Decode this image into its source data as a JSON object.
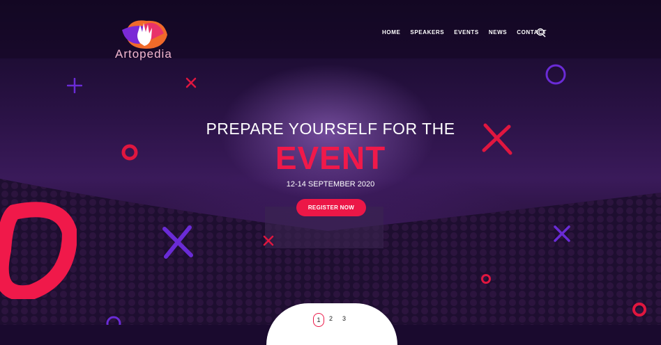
{
  "brand": {
    "name": "Artopedia"
  },
  "nav": {
    "items": [
      "HOME",
      "SPEAKERS",
      "EVENTS",
      "NEWS",
      "CONTACT"
    ]
  },
  "hero": {
    "line1": "PREPARE YOURSELF FOR THE",
    "line2": "EVENT",
    "date": "12-14 SEPTEMBER 2020",
    "cta": "REGISTER NOW"
  },
  "pagination": {
    "pages": [
      "1",
      "2",
      "3"
    ],
    "active": "1"
  },
  "colors": {
    "accent": "#ec1747",
    "purple": "#6a2bd6",
    "bg": "#1a0a2e"
  },
  "icons": {
    "search": "search-icon",
    "logo": "hand-logo-icon"
  }
}
